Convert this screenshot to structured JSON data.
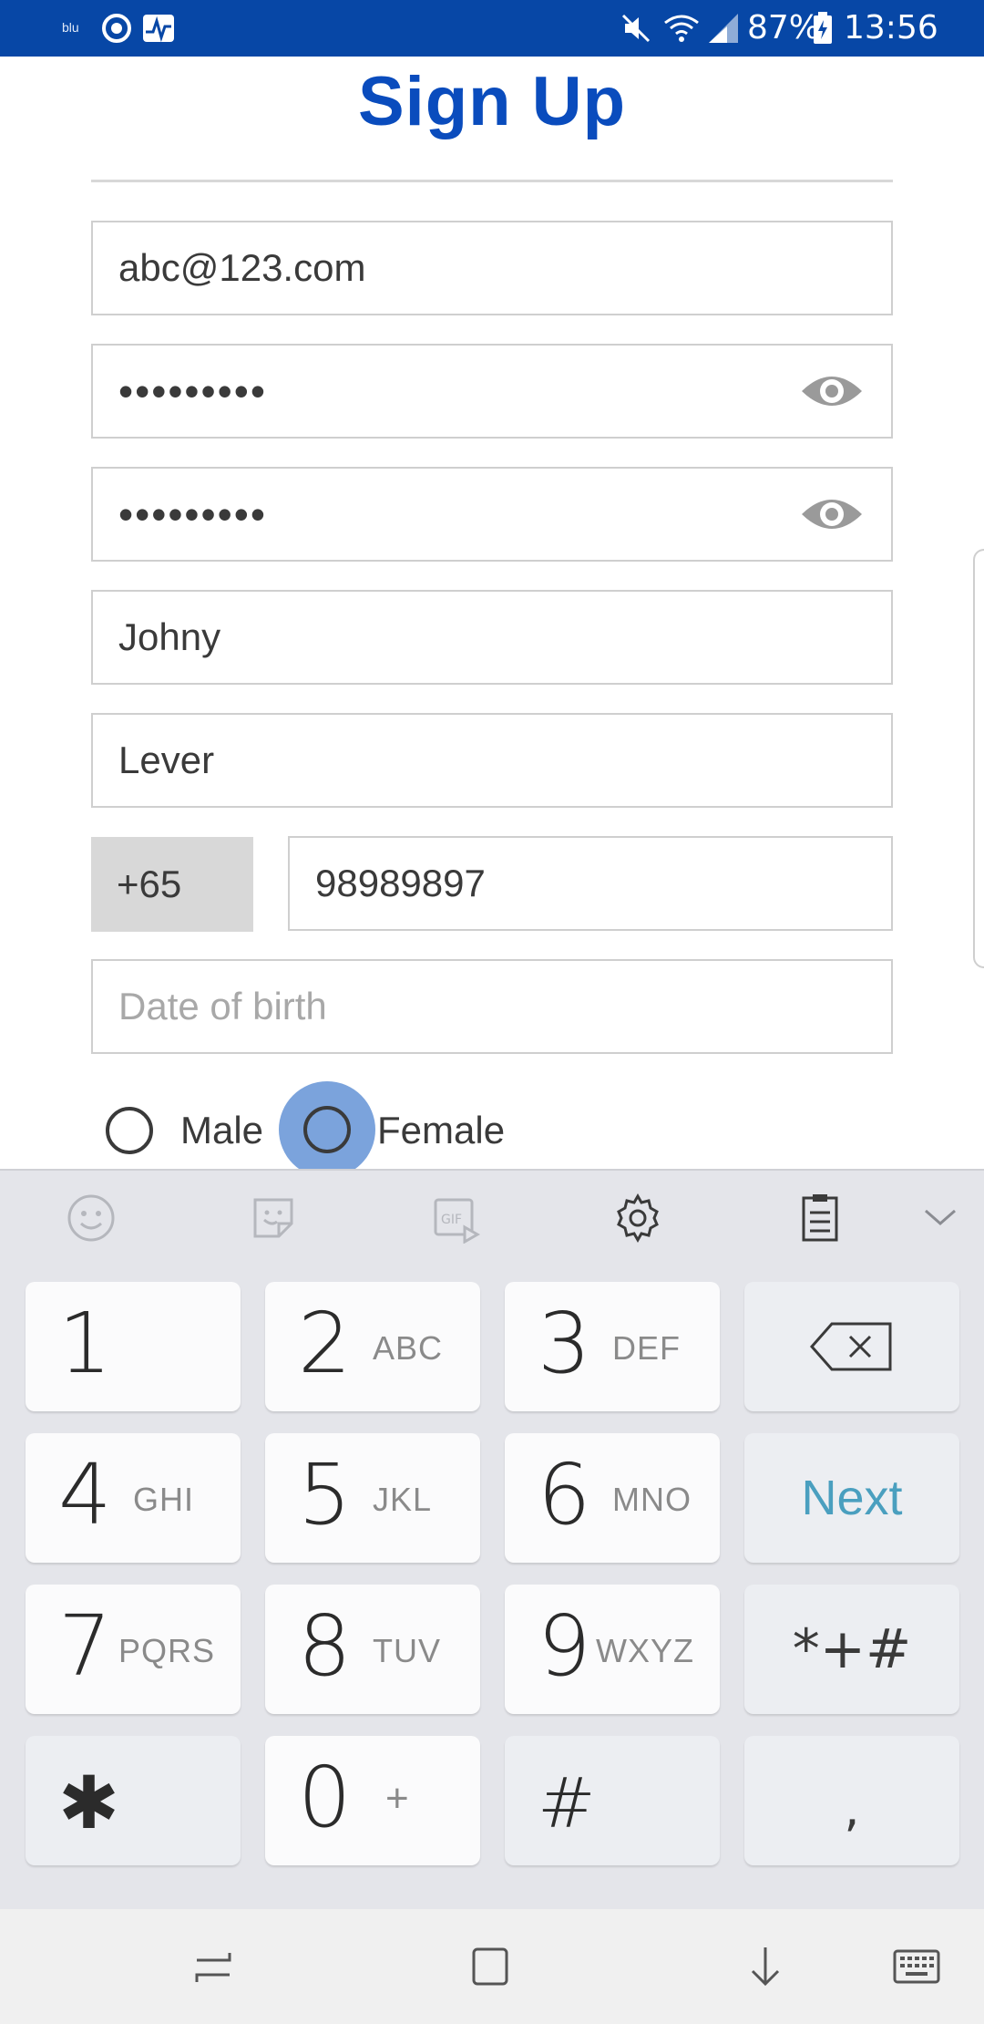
{
  "status_bar": {
    "carrier": "blu",
    "battery_percent": "87%",
    "time": "13:56",
    "icons": [
      "sync-icon",
      "activity-icon",
      "mute-icon",
      "wifi-icon",
      "signal-icon",
      "battery-charging-icon"
    ]
  },
  "header": {
    "title": "Sign Up"
  },
  "form": {
    "email": {
      "value": "abc@123.com"
    },
    "password": {
      "value": "•••••••••"
    },
    "confirm_password": {
      "value": "•••••••••"
    },
    "first_name": {
      "value": "Johny"
    },
    "last_name": {
      "value": "Lever"
    },
    "phone": {
      "country_code": "+65",
      "number": "98989897"
    },
    "dob": {
      "placeholder": "Date of birth"
    },
    "gender": {
      "options": [
        "Male",
        "Female"
      ]
    }
  },
  "keyboard": {
    "toolbar_icons": [
      "emoji-icon",
      "sticker-icon",
      "gif-icon",
      "settings-icon",
      "clipboard-icon",
      "collapse-icon"
    ],
    "keys": [
      {
        "num": "1",
        "letters": ""
      },
      {
        "num": "2",
        "letters": "ABC"
      },
      {
        "num": "3",
        "letters": "DEF"
      },
      {
        "num": "4",
        "letters": "GHI"
      },
      {
        "num": "5",
        "letters": "JKL"
      },
      {
        "num": "6",
        "letters": "MNO"
      },
      {
        "num": "7",
        "letters": "PQRS"
      },
      {
        "num": "8",
        "letters": "TUV"
      },
      {
        "num": "9",
        "letters": "WXYZ"
      },
      {
        "num": "0",
        "letters": "+"
      }
    ],
    "next_label": "Next",
    "symbols_label": "*+#",
    "hash_label": "#",
    "comma_label": ",",
    "asterisk_label": "✱"
  },
  "colors": {
    "status_bar": "#0747a6",
    "title": "#0a4cbd",
    "next": "#4a9fbf",
    "radio_halo": "#7ba3dc"
  }
}
